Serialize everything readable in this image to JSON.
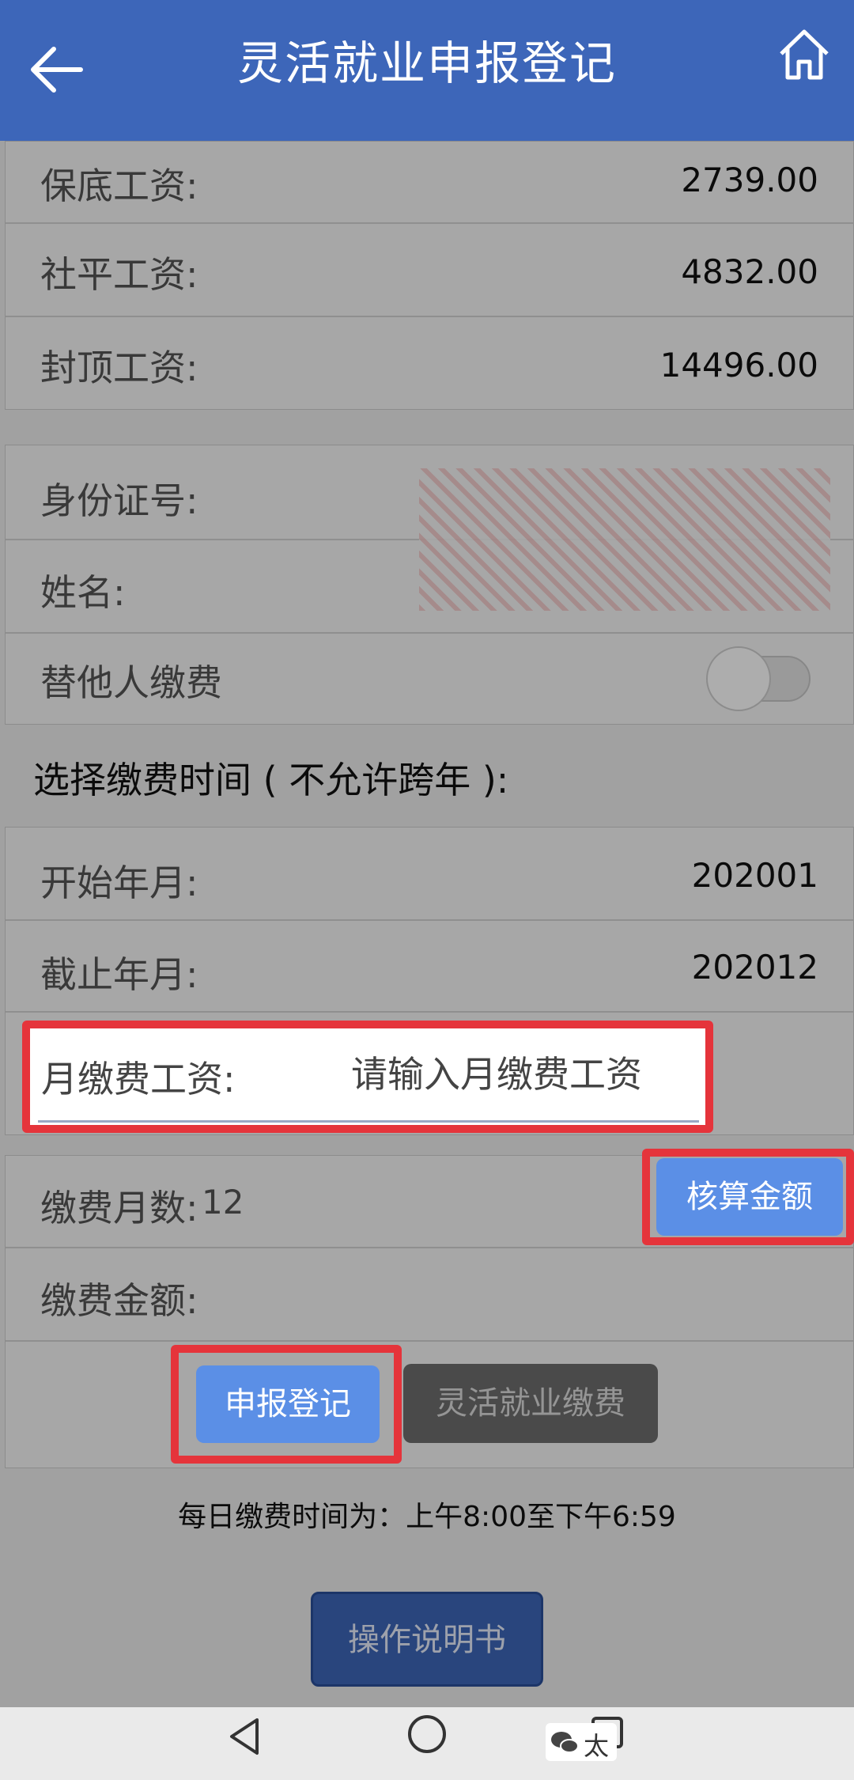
{
  "header": {
    "title": "灵活就业申报登记",
    "back_icon": "arrow-left-icon",
    "home_icon": "home-icon",
    "background": "#3d66b9"
  },
  "wages": {
    "items": [
      {
        "label": "保底工资:",
        "value": "2739.00"
      },
      {
        "label": "社平工资:",
        "value": "4832.00"
      },
      {
        "label": "封顶工资:",
        "value": "14496.00"
      }
    ]
  },
  "person": {
    "id_label": "身份证号:",
    "name_label": "姓名:",
    "pay_for_others_label": "替他人缴费",
    "pay_for_others_on": false
  },
  "period": {
    "section_title": "选择缴费时间 ( 不允许跨年 ):",
    "start_label": "开始年月:",
    "start_value": "202001",
    "end_label": "截止年月:",
    "end_value": "202012"
  },
  "wage_input": {
    "label": "月缴费工资:",
    "placeholder": "请输入月缴费工资"
  },
  "calc": {
    "months_label": "缴费月数:",
    "months_value": "12",
    "calc_button": "核算金额",
    "amount_label": "缴费金额:"
  },
  "actions": {
    "register_button": "申报登记",
    "pay_button": "灵活就业缴费"
  },
  "notice": "每日缴费时间为：上午8:00至下午6:59",
  "manual_button": "操作说明书",
  "nav": {
    "back_icon": "triangle-back-icon",
    "home_icon": "circle-home-icon",
    "recent_icon": "square-recent-icon"
  },
  "watermark": {
    "text": "太",
    "icon": "wechat-icon"
  },
  "colors": {
    "accent": "#3d66b9",
    "highlight": "#e5343b",
    "button_blue": "#5b8fe6",
    "button_gray": "#6e6e6e"
  }
}
